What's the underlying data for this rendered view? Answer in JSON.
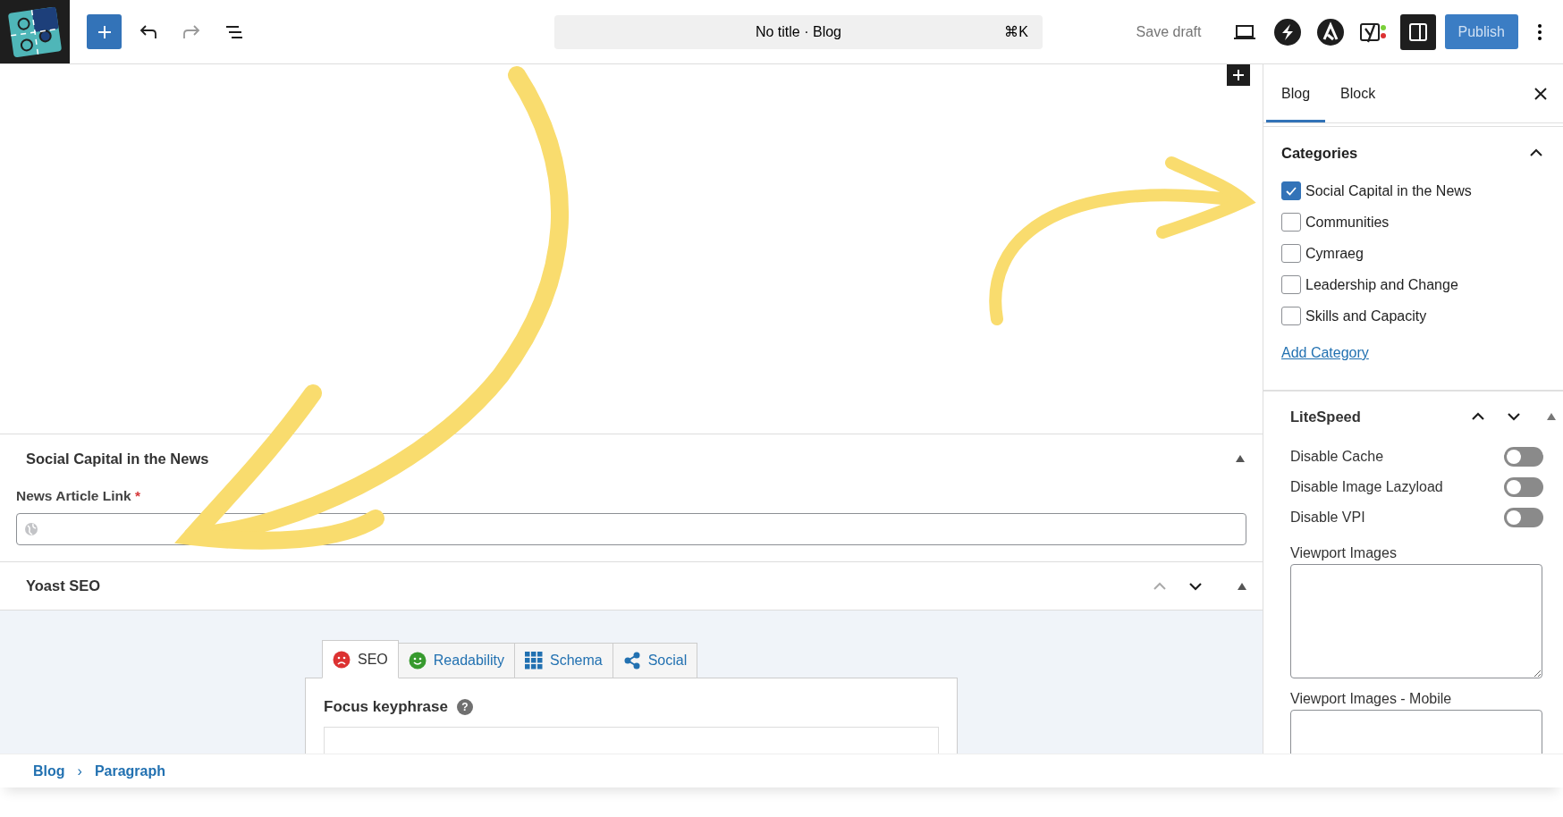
{
  "topbar": {
    "title": "No title · Blog",
    "shortcut": "⌘K",
    "save_draft": "Save draft",
    "publish": "Publish"
  },
  "sidebar": {
    "tabs": [
      {
        "label": "Blog",
        "selected": true
      },
      {
        "label": "Block",
        "selected": false
      }
    ],
    "categories": {
      "title": "Categories",
      "expanded": true,
      "items": [
        {
          "label": "Social Capital in the News",
          "checked": true
        },
        {
          "label": "Communities",
          "checked": false
        },
        {
          "label": "Cymraeg",
          "checked": false
        },
        {
          "label": "Leadership and Change",
          "checked": false
        },
        {
          "label": "Skills and Capacity",
          "checked": false
        }
      ],
      "add_link": "Add Category"
    },
    "litespeed": {
      "title": "LiteSpeed",
      "toggles": [
        {
          "label": "Disable Cache",
          "on": false
        },
        {
          "label": "Disable Image Lazyload",
          "on": false
        },
        {
          "label": "Disable VPI",
          "on": false
        }
      ],
      "textareas": [
        {
          "label": "Viewport Images"
        },
        {
          "label": "Viewport Images - Mobile"
        }
      ]
    }
  },
  "main": {
    "social_panel": {
      "title": "Social Capital in the News",
      "field_label": "News Article Link",
      "required_mark": "*"
    },
    "yoast": {
      "title": "Yoast SEO",
      "tabs": [
        {
          "label": "SEO",
          "kind": "sad",
          "selected": true
        },
        {
          "label": "Readability",
          "kind": "happy",
          "selected": false
        },
        {
          "label": "Schema",
          "kind": "grid",
          "selected": false
        },
        {
          "label": "Social",
          "kind": "share",
          "selected": false
        }
      ],
      "focus_label": "Focus keyphrase",
      "help": "?"
    }
  },
  "breadcrumb": {
    "items": [
      "Blog",
      "Paragraph"
    ],
    "separator": "›"
  }
}
